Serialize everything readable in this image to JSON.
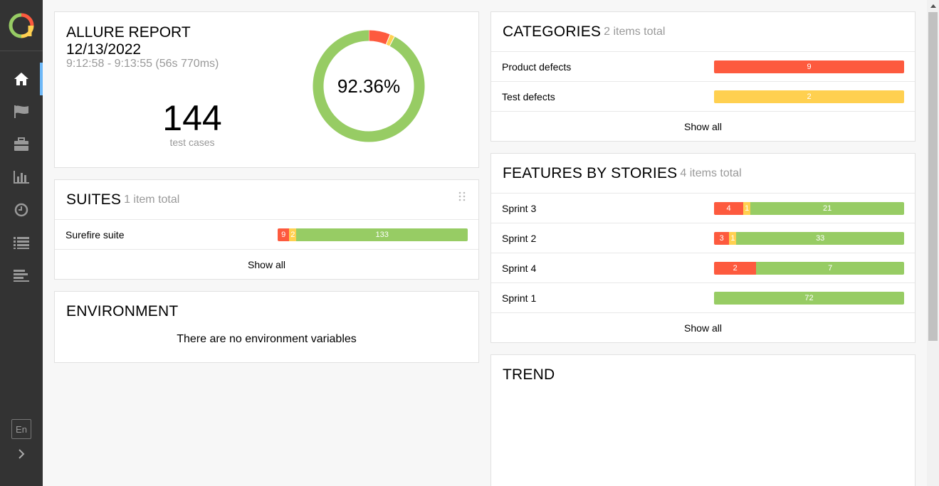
{
  "colors": {
    "failed": "#fd5a3e",
    "broken": "#ffd050",
    "passed": "#97cc64",
    "sidebar": "#333333",
    "accent": "#6eb8f7"
  },
  "sidebar": {
    "items": [
      {
        "icon": "home-icon",
        "active": true
      },
      {
        "icon": "flag-icon",
        "active": false
      },
      {
        "icon": "briefcase-icon",
        "active": false
      },
      {
        "icon": "bar-chart-icon",
        "active": false
      },
      {
        "icon": "clock-icon",
        "active": false
      },
      {
        "icon": "list-icon",
        "active": false
      },
      {
        "icon": "timeline-icon",
        "active": false
      }
    ],
    "language": "En"
  },
  "summary": {
    "title_line1": "ALLURE REPORT",
    "title_line2": "12/13/2022",
    "time_range": "9:12:58 - 9:13:55 (56s 770ms)",
    "count": "144",
    "count_label": "test cases",
    "percent": "92.36%",
    "donut": {
      "failed": 9,
      "broken": 2,
      "passed": 133
    }
  },
  "suites": {
    "title": "SUITES",
    "count": "1 item total",
    "rows": [
      {
        "label": "Surefire suite",
        "failed": 9,
        "broken": 2,
        "passed": 133
      }
    ],
    "show_all": "Show all"
  },
  "environment": {
    "title": "ENVIRONMENT",
    "empty": "There are no environment variables"
  },
  "categories": {
    "title": "CATEGORIES",
    "count": "2 items total",
    "rows": [
      {
        "label": "Product defects",
        "value": 9,
        "status": "failed"
      },
      {
        "label": "Test defects",
        "value": 2,
        "status": "broken"
      }
    ],
    "show_all": "Show all"
  },
  "features": {
    "title": "FEATURES BY STORIES",
    "count": "4 items total",
    "rows": [
      {
        "label": "Sprint 3",
        "failed": 4,
        "broken": 1,
        "passed": 21
      },
      {
        "label": "Sprint 2",
        "failed": 3,
        "broken": 1,
        "passed": 33
      },
      {
        "label": "Sprint 4",
        "failed": 2,
        "broken": 0,
        "passed": 7
      },
      {
        "label": "Sprint 1",
        "failed": 0,
        "broken": 0,
        "passed": 72
      }
    ],
    "show_all": "Show all"
  },
  "trend": {
    "title": "TREND"
  }
}
